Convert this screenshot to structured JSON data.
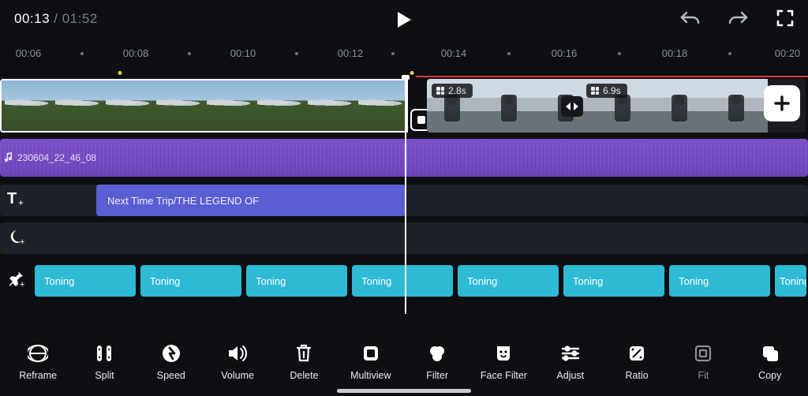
{
  "playback": {
    "current": "00:13",
    "duration": "01:52",
    "separator": " / "
  },
  "ruler": {
    "labels": [
      "00:06",
      "00:08",
      "00:10",
      "00:12",
      "00:14",
      "00:16",
      "00:18",
      "00:20"
    ]
  },
  "video": {
    "clip2": {
      "segment1_duration": "2.8s",
      "segment2_duration": "6.9s"
    }
  },
  "audio": {
    "clip_label": "230604_22_46_08"
  },
  "text_track": {
    "clip_label": "Next Time Trip/THE LEGEND OF"
  },
  "toning": {
    "label": "Toning"
  },
  "toolbar": {
    "reframe": "Reframe",
    "split": "Split",
    "speed": "Speed",
    "volume": "Volume",
    "delete": "Delete",
    "multiview": "Multiview",
    "filter": "Filter",
    "face_filter": "Face Filter",
    "adjust": "Adjust",
    "ratio": "Ratio",
    "fit": "Fit",
    "copy": "Copy"
  }
}
